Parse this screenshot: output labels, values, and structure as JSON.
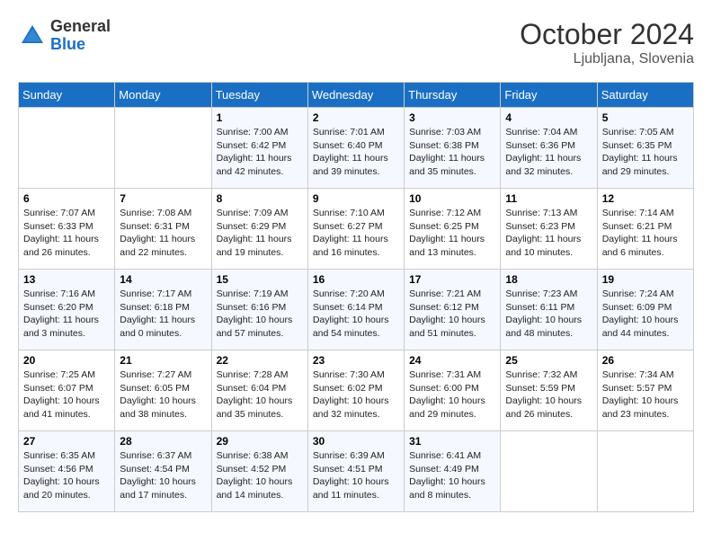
{
  "header": {
    "logo_general": "General",
    "logo_blue": "Blue",
    "month": "October 2024",
    "location": "Ljubljana, Slovenia"
  },
  "days_of_week": [
    "Sunday",
    "Monday",
    "Tuesday",
    "Wednesday",
    "Thursday",
    "Friday",
    "Saturday"
  ],
  "weeks": [
    [
      {
        "num": "",
        "info": ""
      },
      {
        "num": "",
        "info": ""
      },
      {
        "num": "1",
        "info": "Sunrise: 7:00 AM\nSunset: 6:42 PM\nDaylight: 11 hours and 42 minutes."
      },
      {
        "num": "2",
        "info": "Sunrise: 7:01 AM\nSunset: 6:40 PM\nDaylight: 11 hours and 39 minutes."
      },
      {
        "num": "3",
        "info": "Sunrise: 7:03 AM\nSunset: 6:38 PM\nDaylight: 11 hours and 35 minutes."
      },
      {
        "num": "4",
        "info": "Sunrise: 7:04 AM\nSunset: 6:36 PM\nDaylight: 11 hours and 32 minutes."
      },
      {
        "num": "5",
        "info": "Sunrise: 7:05 AM\nSunset: 6:35 PM\nDaylight: 11 hours and 29 minutes."
      }
    ],
    [
      {
        "num": "6",
        "info": "Sunrise: 7:07 AM\nSunset: 6:33 PM\nDaylight: 11 hours and 26 minutes."
      },
      {
        "num": "7",
        "info": "Sunrise: 7:08 AM\nSunset: 6:31 PM\nDaylight: 11 hours and 22 minutes."
      },
      {
        "num": "8",
        "info": "Sunrise: 7:09 AM\nSunset: 6:29 PM\nDaylight: 11 hours and 19 minutes."
      },
      {
        "num": "9",
        "info": "Sunrise: 7:10 AM\nSunset: 6:27 PM\nDaylight: 11 hours and 16 minutes."
      },
      {
        "num": "10",
        "info": "Sunrise: 7:12 AM\nSunset: 6:25 PM\nDaylight: 11 hours and 13 minutes."
      },
      {
        "num": "11",
        "info": "Sunrise: 7:13 AM\nSunset: 6:23 PM\nDaylight: 11 hours and 10 minutes."
      },
      {
        "num": "12",
        "info": "Sunrise: 7:14 AM\nSunset: 6:21 PM\nDaylight: 11 hours and 6 minutes."
      }
    ],
    [
      {
        "num": "13",
        "info": "Sunrise: 7:16 AM\nSunset: 6:20 PM\nDaylight: 11 hours and 3 minutes."
      },
      {
        "num": "14",
        "info": "Sunrise: 7:17 AM\nSunset: 6:18 PM\nDaylight: 11 hours and 0 minutes."
      },
      {
        "num": "15",
        "info": "Sunrise: 7:19 AM\nSunset: 6:16 PM\nDaylight: 10 hours and 57 minutes."
      },
      {
        "num": "16",
        "info": "Sunrise: 7:20 AM\nSunset: 6:14 PM\nDaylight: 10 hours and 54 minutes."
      },
      {
        "num": "17",
        "info": "Sunrise: 7:21 AM\nSunset: 6:12 PM\nDaylight: 10 hours and 51 minutes."
      },
      {
        "num": "18",
        "info": "Sunrise: 7:23 AM\nSunset: 6:11 PM\nDaylight: 10 hours and 48 minutes."
      },
      {
        "num": "19",
        "info": "Sunrise: 7:24 AM\nSunset: 6:09 PM\nDaylight: 10 hours and 44 minutes."
      }
    ],
    [
      {
        "num": "20",
        "info": "Sunrise: 7:25 AM\nSunset: 6:07 PM\nDaylight: 10 hours and 41 minutes."
      },
      {
        "num": "21",
        "info": "Sunrise: 7:27 AM\nSunset: 6:05 PM\nDaylight: 10 hours and 38 minutes."
      },
      {
        "num": "22",
        "info": "Sunrise: 7:28 AM\nSunset: 6:04 PM\nDaylight: 10 hours and 35 minutes."
      },
      {
        "num": "23",
        "info": "Sunrise: 7:30 AM\nSunset: 6:02 PM\nDaylight: 10 hours and 32 minutes."
      },
      {
        "num": "24",
        "info": "Sunrise: 7:31 AM\nSunset: 6:00 PM\nDaylight: 10 hours and 29 minutes."
      },
      {
        "num": "25",
        "info": "Sunrise: 7:32 AM\nSunset: 5:59 PM\nDaylight: 10 hours and 26 minutes."
      },
      {
        "num": "26",
        "info": "Sunrise: 7:34 AM\nSunset: 5:57 PM\nDaylight: 10 hours and 23 minutes."
      }
    ],
    [
      {
        "num": "27",
        "info": "Sunrise: 6:35 AM\nSunset: 4:56 PM\nDaylight: 10 hours and 20 minutes."
      },
      {
        "num": "28",
        "info": "Sunrise: 6:37 AM\nSunset: 4:54 PM\nDaylight: 10 hours and 17 minutes."
      },
      {
        "num": "29",
        "info": "Sunrise: 6:38 AM\nSunset: 4:52 PM\nDaylight: 10 hours and 14 minutes."
      },
      {
        "num": "30",
        "info": "Sunrise: 6:39 AM\nSunset: 4:51 PM\nDaylight: 10 hours and 11 minutes."
      },
      {
        "num": "31",
        "info": "Sunrise: 6:41 AM\nSunset: 4:49 PM\nDaylight: 10 hours and 8 minutes."
      },
      {
        "num": "",
        "info": ""
      },
      {
        "num": "",
        "info": ""
      }
    ]
  ]
}
